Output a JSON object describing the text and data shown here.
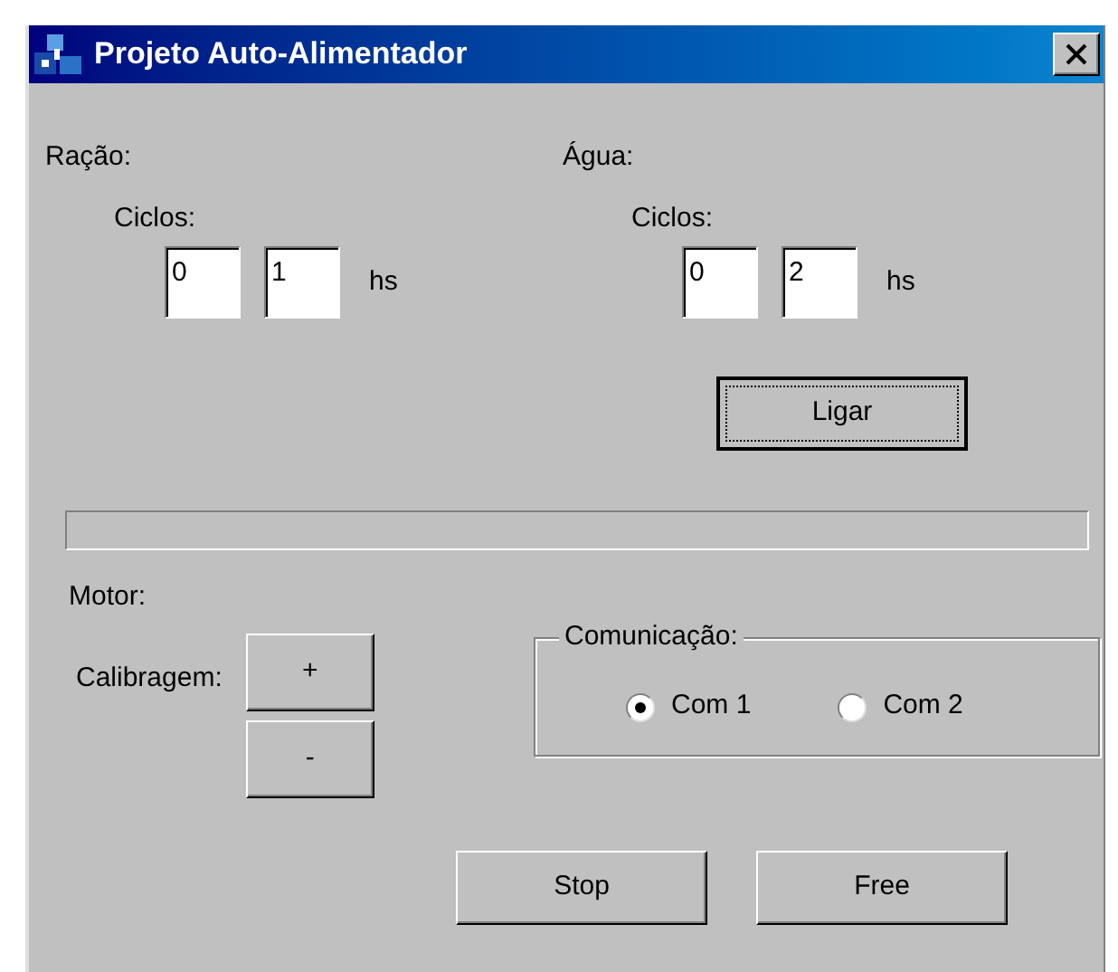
{
  "window": {
    "title": "Projeto Auto-Alimentador"
  },
  "feeds": [
    {
      "label": "Ração:",
      "ciclos_label": "Ciclos:",
      "fields": [
        "0",
        "1"
      ],
      "unit": "hs"
    },
    {
      "label": "Água:",
      "ciclos_label": "Ciclos:",
      "fields": [
        "0",
        "2"
      ],
      "unit": "hs"
    }
  ],
  "ligar_button": {
    "label": "Ligar",
    "focused": true
  },
  "progress": {
    "level": 0
  },
  "motor": {
    "label": "Motor:",
    "calibragem_label": "Calibragem:",
    "buttons": [
      "+",
      "-"
    ]
  },
  "comunicacao": {
    "title": "Comunicação:",
    "options": [
      {
        "label": "Com 1",
        "selected": true
      },
      {
        "label": "Com 2",
        "selected": false
      }
    ]
  },
  "buttons": [
    "Stop",
    "Free"
  ]
}
